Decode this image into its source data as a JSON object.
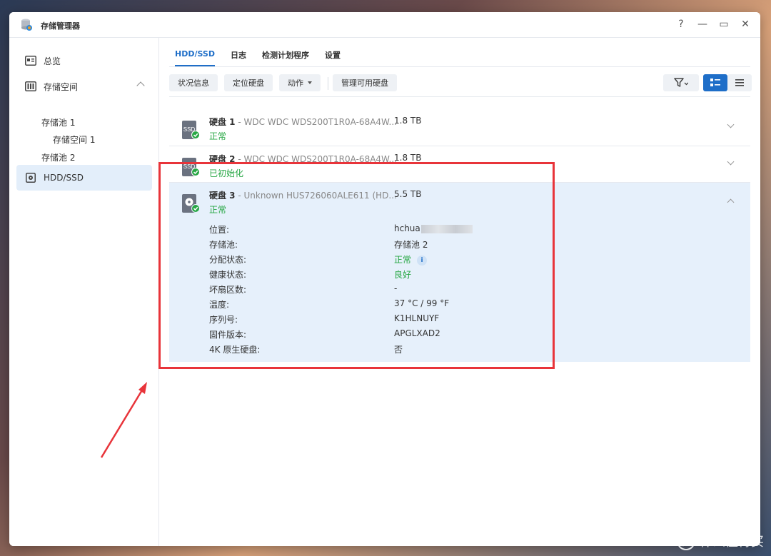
{
  "window": {
    "title": "存储管理器"
  },
  "controls": {
    "help": "?",
    "minimize": "—",
    "maximize": "▭",
    "close": "✕"
  },
  "sidebar": {
    "items": [
      {
        "label": "总览"
      },
      {
        "label": "存储空间"
      },
      {
        "label": "HDD/SSD"
      }
    ],
    "sub_items": [
      {
        "label": "存储池 1"
      },
      {
        "label": "存储空间 1"
      },
      {
        "label": "存储池 2"
      }
    ]
  },
  "tabs": [
    {
      "label": "HDD/SSD"
    },
    {
      "label": "日志"
    },
    {
      "label": "检测计划程序"
    },
    {
      "label": "设置"
    }
  ],
  "toolbar": {
    "status_info": "状况信息",
    "locate_disk": "定位硬盘",
    "action": "动作",
    "manage_available": "管理可用硬盘"
  },
  "disks": [
    {
      "label": "硬盘 1",
      "model": " - WDC WDC WDS200T1R0A-68A4W...",
      "size": "1.8 TB",
      "status": "正常",
      "icon_text": "SSD"
    },
    {
      "label": "硬盘 2",
      "model": " - WDC WDC WDS200T1R0A-68A4W...",
      "size": "1.8 TB",
      "status": "已初始化",
      "icon_text": "SSD"
    },
    {
      "label": "硬盘 3",
      "model": " - Unknown HUS726060ALE611 (HD...",
      "size": "5.5 TB",
      "status": "正常"
    }
  ],
  "details": [
    {
      "label": "位置:",
      "value": "hchua"
    },
    {
      "label": "存储池:",
      "value": "存储池 2"
    },
    {
      "label": "分配状态:",
      "value": "正常",
      "info": "i"
    },
    {
      "label": "健康状态:",
      "value": "良好"
    },
    {
      "label": "坏扇区数:",
      "value": "-"
    },
    {
      "label": "温度:",
      "value": "37 °C / 99 °F"
    },
    {
      "label": "序列号:",
      "value": "K1HLNUYF"
    },
    {
      "label": "固件版本:",
      "value": "APGLXAD2"
    },
    {
      "label": "4K 原生硬盘:",
      "value": "否"
    }
  ],
  "watermark": {
    "logo": "值",
    "text": "什么值得买"
  },
  "colors": {
    "accent": "#1e6ec8",
    "ok": "#28a745",
    "highlight": "#e8343a",
    "selected_row": "#e6f0fb"
  }
}
